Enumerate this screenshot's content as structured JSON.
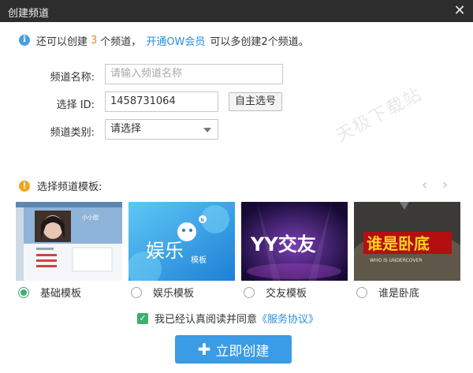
{
  "window": {
    "title": "创建频道",
    "close_glyph": "✕"
  },
  "info": {
    "prefix": "还可以创建",
    "count": "3",
    "suffix": "个频道，",
    "link": "开通OW会员",
    "tail": "可以多创建2个频道。"
  },
  "form": {
    "name_label": "频道名称:",
    "name_placeholder": "请输入频道名称",
    "id_label": "选择 ID:",
    "id_value": "1458731064",
    "self_pick_label": "自主选号",
    "category_label": "频道类别:",
    "category_value": "请选择"
  },
  "watermark": "天极下载站",
  "templates": {
    "heading": "选择频道模板:",
    "items": [
      {
        "label": "基础模板",
        "selected": true,
        "thumb_text": "小小图"
      },
      {
        "label": "娱乐模板",
        "selected": false,
        "thumb_text": "娱乐",
        "thumb_sub": "模板",
        "thumb_badge": "N"
      },
      {
        "label": "交友模板",
        "selected": false,
        "thumb_text": "YY交友"
      },
      {
        "label": "谁是卧底",
        "selected": false,
        "thumb_text": "谁是卧底",
        "thumb_sub": "WHO IS UNDERCOVER"
      }
    ]
  },
  "agreement": {
    "text": "我已经认真阅读并同意",
    "link": "《服务协议》"
  },
  "create_button": {
    "label": "立即创建"
  },
  "colors": {
    "accent": "#3a9be6",
    "titlebar": "#2d2d2d",
    "green": "#3cb06c",
    "orange": "#f08a24"
  }
}
